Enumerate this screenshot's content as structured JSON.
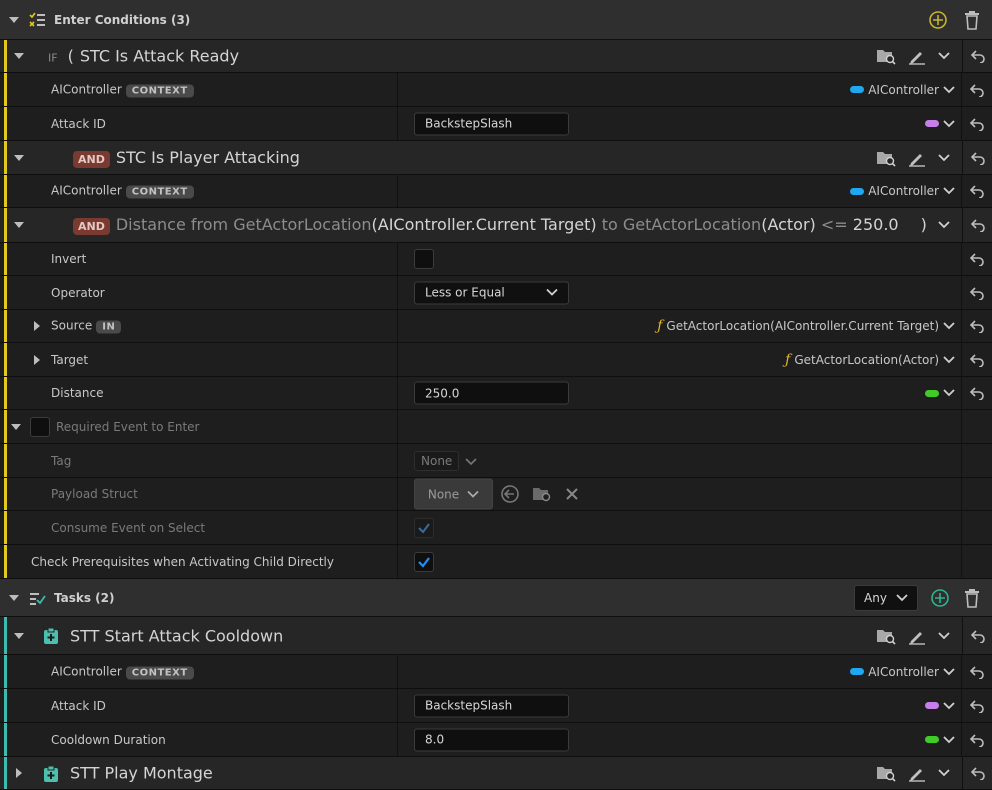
{
  "enter_conditions": {
    "header": "Enter Conditions (3)"
  },
  "cond1": {
    "if_label": "IF",
    "open_paren": "(",
    "title": "STC Is Attack Ready"
  },
  "cond1_props": {
    "aicontroller_label": "AIController",
    "context_badge": "CONTEXT",
    "aicontroller_value": "AIController",
    "attack_id_label": "Attack ID",
    "attack_id_value": "BackstepSlash"
  },
  "cond2": {
    "and_label": "AND",
    "title": "STC Is Player Attacking"
  },
  "cond2_props": {
    "aicontroller_label": "AIController",
    "context_badge": "CONTEXT",
    "aicontroller_value": "AIController"
  },
  "cond3": {
    "and_label": "AND",
    "t1": "Distance from GetActorLocation",
    "t2": "(AIController.Current Target)",
    "t3": " to GetActorLocation",
    "t4": "(Actor)",
    "t5": " <= ",
    "t6": "250.0",
    "close_paren": ")"
  },
  "cond3_props": {
    "invert_label": "Invert",
    "operator_label": "Operator",
    "operator_value": "Less or Equal",
    "source_label": "Source",
    "in_badge": "IN",
    "source_value": "GetActorLocation(AIController.Current Target)",
    "target_label": "Target",
    "target_value": "GetActorLocation(Actor)",
    "distance_label": "Distance",
    "distance_value": "250.0"
  },
  "required_event": {
    "label": "Required Event to Enter",
    "tag_label": "Tag",
    "tag_value": "None",
    "payload_label": "Payload Struct",
    "payload_value": "None",
    "consume_label": "Consume Event on Select"
  },
  "check_prereq": {
    "label": "Check Prerequisites when Activating Child Directly"
  },
  "tasks": {
    "header": "Tasks (2)",
    "mode_value": "Any"
  },
  "task1": {
    "title": "STT Start Attack Cooldown",
    "aicontroller_label": "AIController",
    "context_badge": "CONTEXT",
    "aicontroller_value": "AIController",
    "attack_id_label": "Attack ID",
    "attack_id_value": "BackstepSlash",
    "cooldown_label": "Cooldown Duration",
    "cooldown_value": "8.0"
  },
  "task2": {
    "title": "STT Play Montage"
  },
  "colors": {
    "condition_bar": "#e2c81f",
    "task_bar": "#3bbcae",
    "object_pin": "#1fa8f0",
    "name_pin": "#c77ee8",
    "float_pin": "#3fcc29",
    "function_icon": "#e6b52c",
    "and_badge": "#7a3a30",
    "add_icon": "#c8b42a",
    "add_icon_tasks": "#2fb38f"
  }
}
